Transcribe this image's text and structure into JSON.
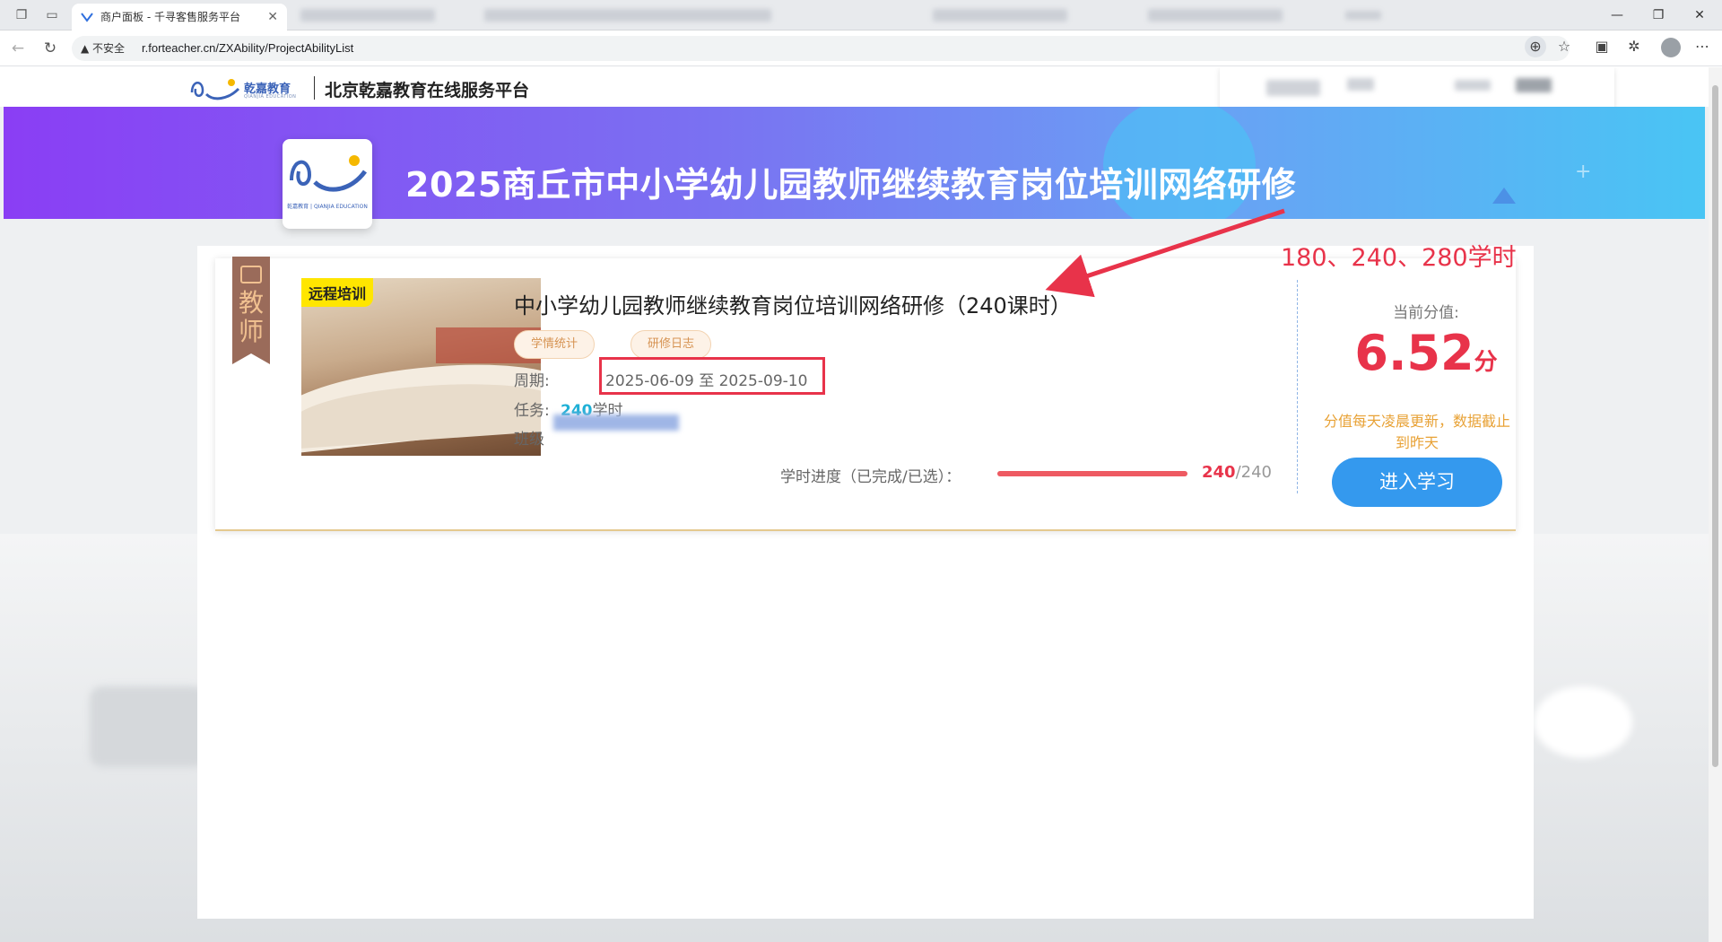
{
  "browser": {
    "tabs": [
      {
        "title": "商户面板 - 千寻客售服务平台",
        "active": true
      }
    ],
    "address": {
      "security_label": "不安全",
      "url": "r.forteacher.cn/ZXAbility/ProjectAbilityList"
    }
  },
  "site": {
    "logo_text": "乾嘉教育",
    "logo_subtext": "QIANJIA EDUCATION",
    "platform_name": "北京乾嘉教育在线服务平台"
  },
  "banner": {
    "title": "2025商丘市中小学幼儿园教师继续教育岗位培训网络研修",
    "logo_caption": "乾嘉教育 | QIANJIA EDUCATION"
  },
  "course": {
    "ribbon_label": "教师",
    "cover_tag": "远程培训",
    "title": "中小学幼儿园教师继续教育岗位培训网络研修（240课时）",
    "buttons": [
      "学情统计",
      "研修日志"
    ],
    "period_label": "周期:",
    "period_value": "2025-06-09 至 2025-09-10",
    "task_label": "任务:",
    "task_hours": "240",
    "task_unit": "学时",
    "class_label": "班级",
    "progress_label": "学时进度（已完成/已选）：",
    "progress_done": "240",
    "progress_total": "/240",
    "progress_fraction": 1.0,
    "score_label": "当前分值:",
    "score_value": "6.52",
    "score_unit": "分",
    "score_note": "分值每天凌晨更新，数据截止到昨天",
    "enter_button": "进入学习"
  },
  "annotation": {
    "text": "180、240、280学时",
    "color": "#e8334a"
  },
  "colors": {
    "accent_blue": "#3499ee",
    "highlight_red": "#e8334a",
    "banner_start": "#8a3ef4",
    "banner_end": "#49c5f4"
  }
}
